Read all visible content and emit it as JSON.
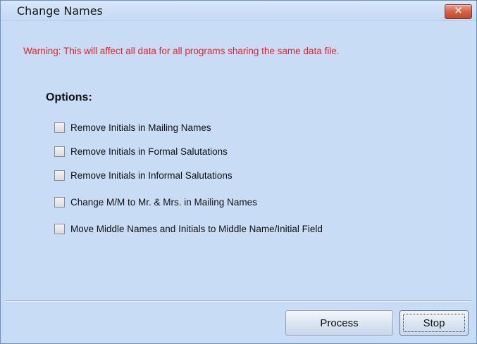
{
  "window": {
    "title": "Change Names",
    "close_glyph": "✕"
  },
  "warning": "Warning: This will affect all data for all programs sharing the same data file.",
  "options": {
    "heading": "Options:",
    "items": [
      {
        "label": "Remove Initials in Mailing Names",
        "checked": false
      },
      {
        "label": "Remove Initials in Formal Salutations",
        "checked": false
      },
      {
        "label": "Remove Initials in Informal Salutations",
        "checked": false
      },
      {
        "label": "Change M/M to Mr. & Mrs. in Mailing Names",
        "checked": false
      },
      {
        "label": "Move Middle Names and Initials to Middle Name/Initial Field",
        "checked": false
      }
    ]
  },
  "buttons": {
    "process": "Process",
    "stop": "Stop"
  },
  "colors": {
    "background": "#c9dcf6",
    "warning": "#e8232a",
    "close_button": "#cf5f42"
  },
  "icons": {
    "close": "close-icon"
  }
}
